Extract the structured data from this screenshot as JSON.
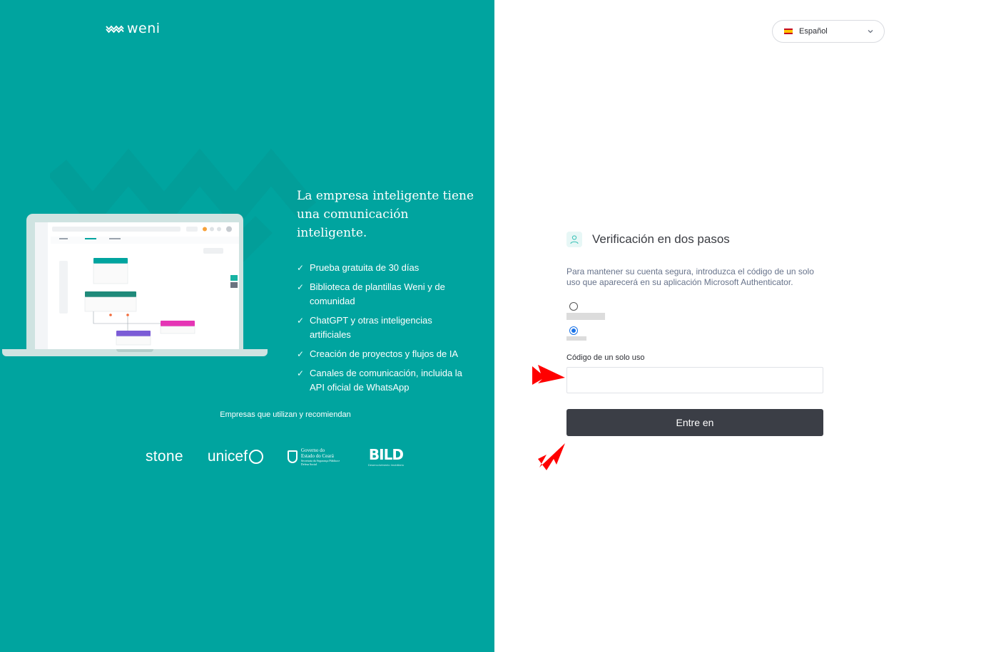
{
  "brand": {
    "logo_text": "weni"
  },
  "hero": {
    "headline": "La empresa inteligente tiene una comunicación inteligente.",
    "features": [
      "Prueba gratuita de 30 días",
      "Biblioteca de plantillas Weni y de comunidad",
      "ChatGPT y otras inteligencias artificiales",
      "Creación de proyectos y flujos de IA",
      "Canales de comunicación, incluida la API oficial de WhatsApp"
    ],
    "companies_title": "Empresas que utilizan y recomiendan",
    "company_logos": {
      "stone": "stone",
      "unicef": "unicef",
      "ceara_line1": "Governo do",
      "ceara_line2": "Estado do Ceará",
      "ceara_line3": "Secretaria da Segurança Pública e Defesa Social",
      "bild": "BILD",
      "bild_sub": "Desenvolvimento Imobiliário"
    }
  },
  "language_selector": {
    "label": "Español",
    "flag": "spain-flag-icon"
  },
  "verification": {
    "title": "Verificación en dos pasos",
    "description": "Para mantener su cuenta segura, introduzca el código de un solo uso que aparecerá en su aplicación Microsoft Authenticator.",
    "options": [
      {
        "checked": false
      },
      {
        "checked": true
      }
    ],
    "code_label": "Código de un solo uso",
    "code_value": "",
    "code_placeholder": "",
    "submit_label": "Entre en"
  },
  "colors": {
    "left_panel": "#00a49f",
    "submit_button": "#3b3e46",
    "annotation_arrow": "#ff0000"
  }
}
